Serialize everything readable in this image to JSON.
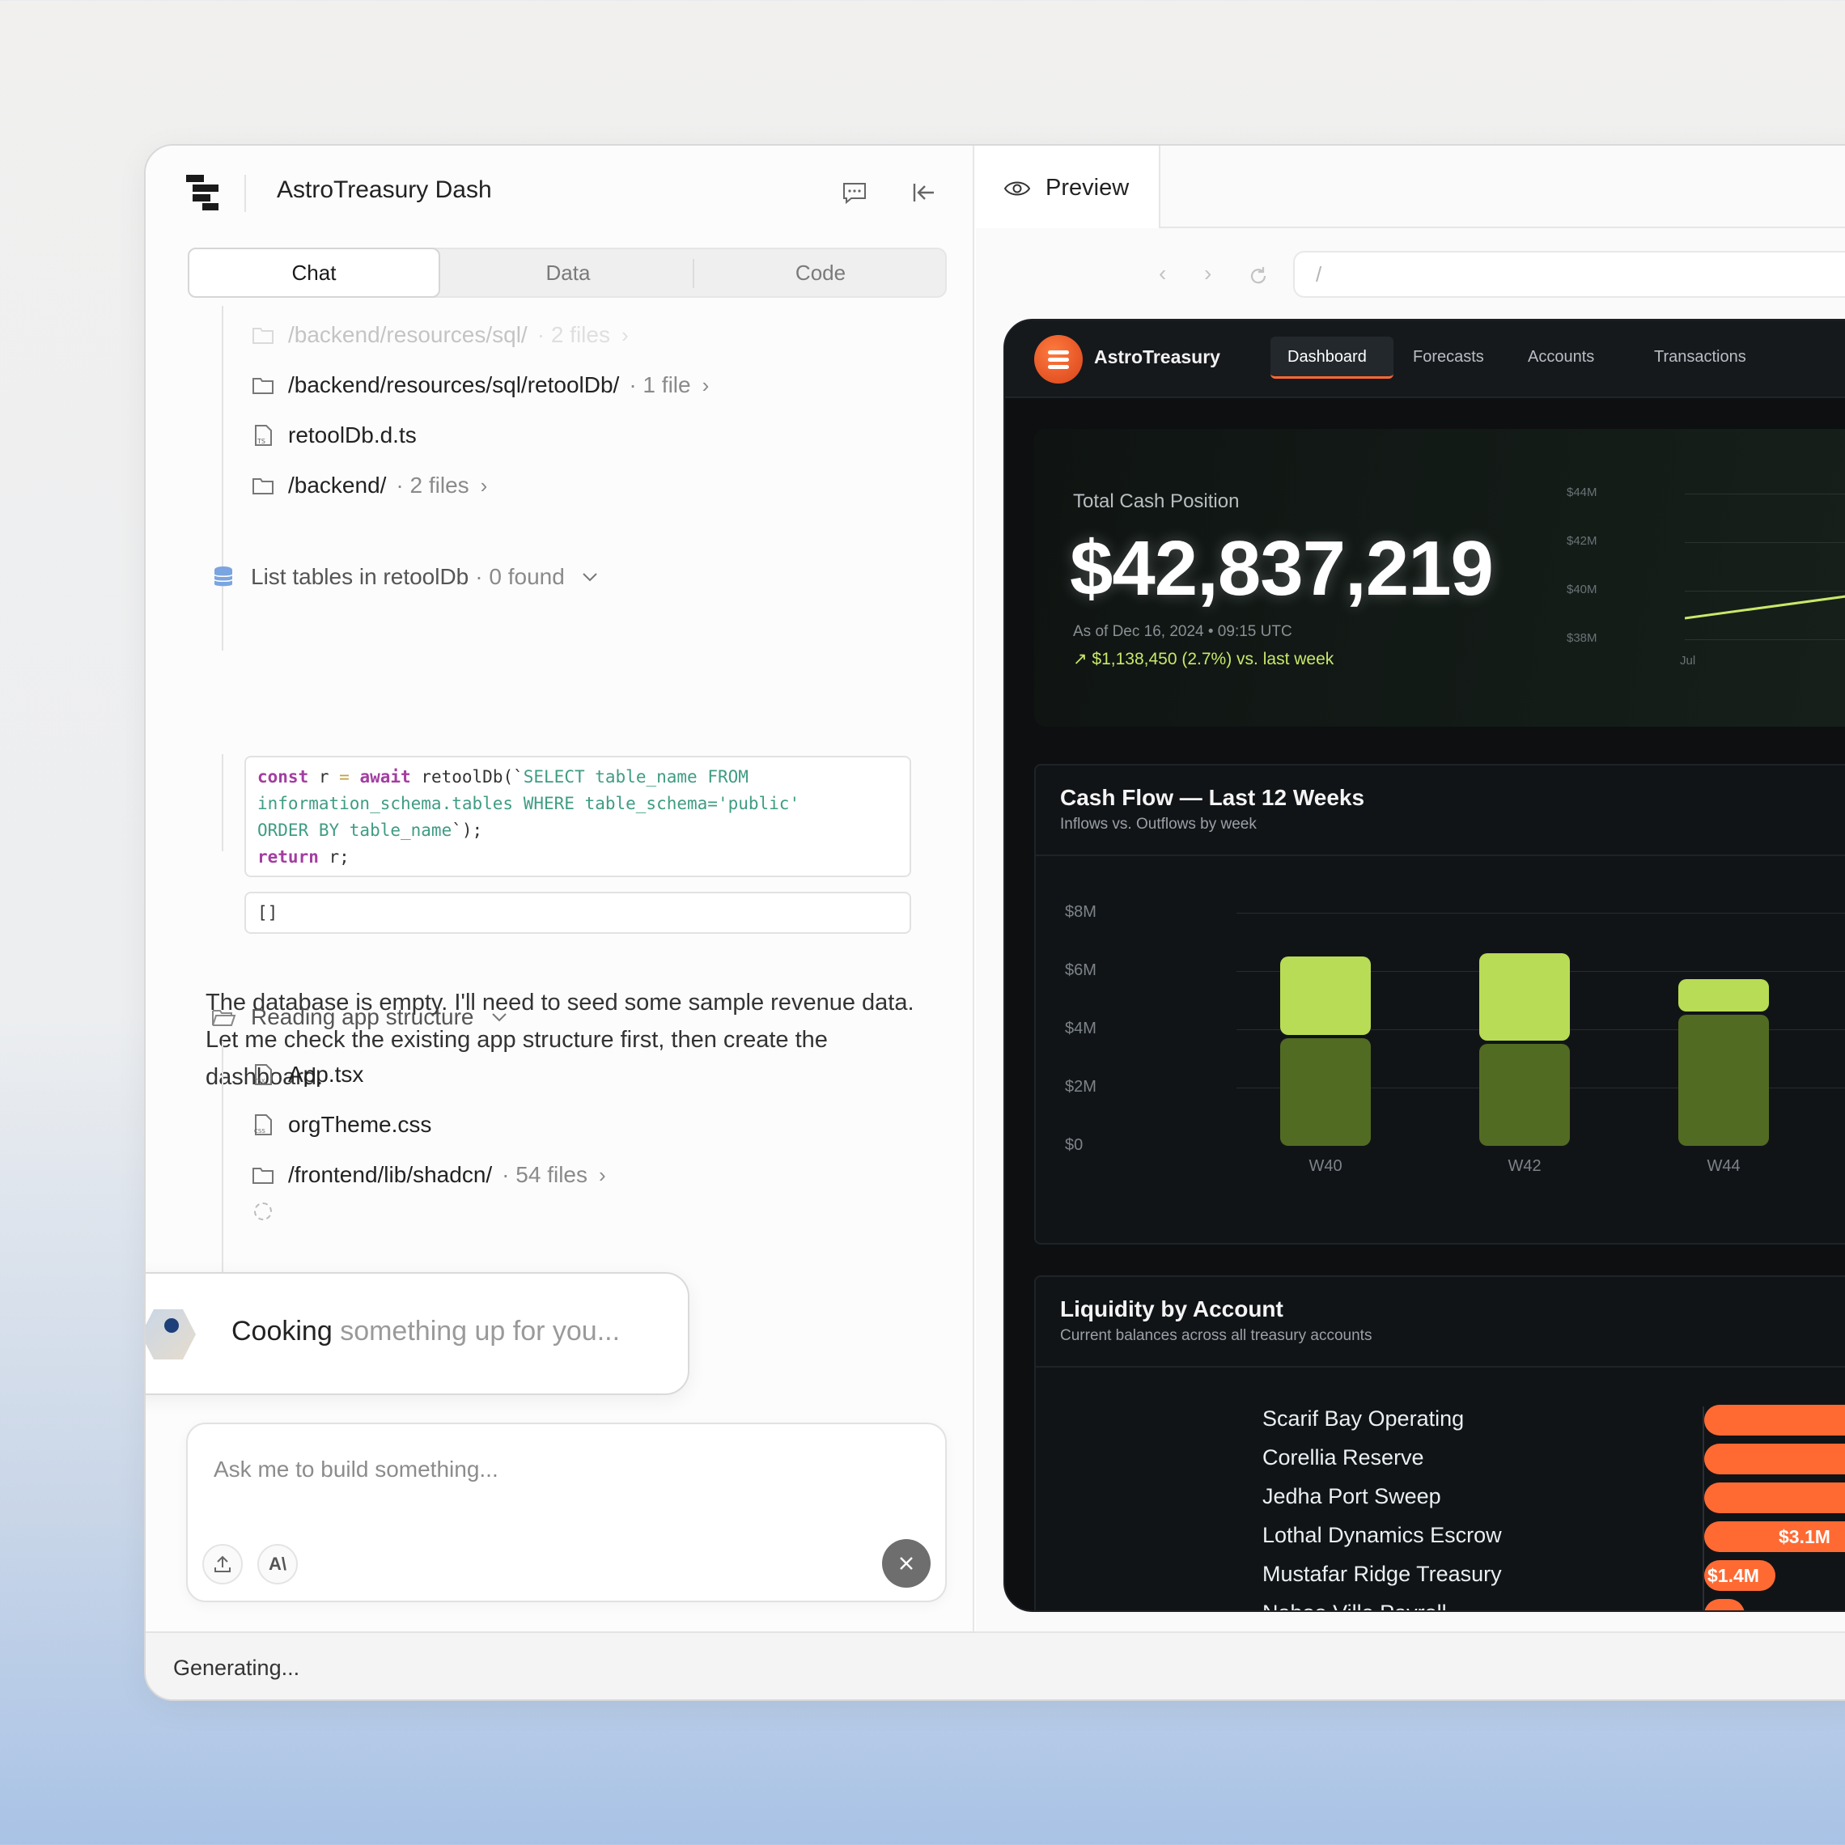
{
  "header": {
    "title": "AstroTreasury Dash"
  },
  "tabs": [
    {
      "label": "Chat"
    },
    {
      "label": "Data"
    },
    {
      "label": "Code"
    }
  ],
  "files_top": [
    {
      "path": "/backend/resources/sql/",
      "meta": "· 2 files"
    },
    {
      "path": "/backend/resources/sql/retoolDb/",
      "meta": "· 1 file"
    },
    {
      "path": "retoolDb.d.ts",
      "meta": ""
    },
    {
      "path": "/backend/",
      "meta": "· 2 files"
    }
  ],
  "list_tables": {
    "title": "List tables in retoolDb",
    "meta": "· 0 found"
  },
  "code": {
    "line1_kw1": "const",
    "line1_var": " r ",
    "line1_op": "=",
    "line1_kw2": " await",
    "line1_fn": " retoolDb(`",
    "line1_str": "SELECT table_name FROM",
    "line2_str": "information_schema.tables WHERE table_schema='public'",
    "line3_str": "ORDER BY table_name",
    "line3_end": "`);",
    "line4_kw": "return",
    "line4_rest": " r;",
    "result": "[]"
  },
  "message": "The database is empty. I'll need to seed some sample revenue data. Let me check the existing app structure first, then create the dashboard.",
  "reading": {
    "title": "Reading app structure"
  },
  "files_bottom": [
    {
      "path": "App.tsx",
      "meta": ""
    },
    {
      "path": "orgTheme.css",
      "meta": ""
    },
    {
      "path": "/frontend/lib/shadcn/",
      "meta": "· 54 files"
    }
  ],
  "cooking": {
    "strong": "Cooking",
    "rest": " something up for you..."
  },
  "composer": {
    "placeholder": "Ask me to build something..."
  },
  "status": "Generating...",
  "preview": {
    "tab_label": "Preview",
    "url": "/"
  },
  "app": {
    "brand": "AstroTreasury",
    "nav": [
      "Dashboard",
      "Forecasts",
      "Accounts",
      "Transactions"
    ],
    "cash": {
      "label": "Total Cash Position",
      "value": "$42,837,219",
      "as_of": "As of Dec 16, 2024 • 09:15 UTC",
      "change": "↗ $1,138,450 (2.7%) vs. last week",
      "y_ticks": [
        "$44M",
        "$42M",
        "$40M",
        "$38M"
      ],
      "x_tick": "Jul"
    },
    "cashflow": {
      "title": "Cash Flow — Last 12 Weeks",
      "subtitle": "Inflows vs. Outflows by week",
      "y_ticks": [
        "$8M",
        "$6M",
        "$4M",
        "$2M",
        "$0"
      ],
      "x_ticks": [
        "W40",
        "W42",
        "W44"
      ]
    },
    "liquidity": {
      "title": "Liquidity by Account",
      "subtitle": "Current balances across all treasury accounts",
      "accounts": [
        "Scarif Bay Operating",
        "Corellia Reserve",
        "Jedha Port Sweep",
        "Lothal Dynamics Escrow",
        "Mustafar Ridge Treasury",
        "Naboo Ville Payroll"
      ],
      "values": [
        "",
        "",
        "",
        "$3.1M",
        "$1.4M",
        ""
      ]
    }
  },
  "colors": {
    "accent": "#ff6a33",
    "inflow": "#b8dc55",
    "outflow": "#526b22",
    "positive": "#c9e86a"
  },
  "chart_data": {
    "type": "bar",
    "title": "Cash Flow — Last 12 Weeks",
    "categories": [
      "W40",
      "W42",
      "W44"
    ],
    "series": [
      {
        "name": "Inflows",
        "values": [
          2.7,
          3.0,
          1.1
        ]
      },
      {
        "name": "Outflows",
        "values": [
          3.7,
          3.5,
          4.5
        ]
      }
    ],
    "ylim": [
      0,
      8
    ],
    "y_ticks": [
      "$8M",
      "$6M",
      "$4M",
      "$2M",
      "$0"
    ]
  }
}
